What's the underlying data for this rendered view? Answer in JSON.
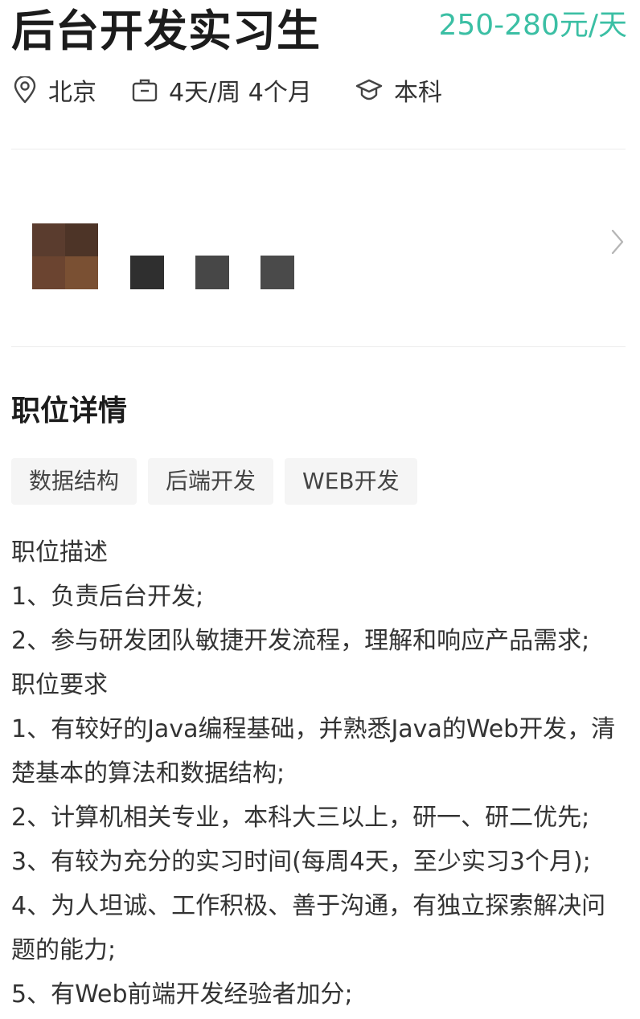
{
  "header": {
    "title": "后台开发实习生",
    "salary": "250-280元/天"
  },
  "meta": {
    "location": "北京",
    "schedule": "4天/周 4个月",
    "education": "本科",
    "icons": [
      "location-pin-icon",
      "briefcase-icon",
      "graduation-cap-icon"
    ]
  },
  "details": {
    "section_title": "职位详情",
    "tags": [
      "数据结构",
      "后端开发",
      "WEB开发"
    ],
    "lines": [
      "职位描述",
      "1、负责后台开发;",
      "2、参与研发团队敏捷开发流程，理解和响应产品需求;",
      "职位要求",
      "1、有较好的Java编程基础，并熟悉Java的Web开发，清",
      "楚基本的算法和数据结构;",
      "2、计算机相关专业，本科大三以上，研一、研二优先;",
      "3、有较为充分的实习时间(每周4天，至少实习3个月);",
      "4、为人坦诚、工作积极、善于沟通，有独立探索解决问",
      "题的能力;",
      "5、有Web前端开发经验者加分;"
    ]
  },
  "colors": {
    "salary": "#3bbfa4",
    "title": "#1c1c1c",
    "tag_background": "#f5f5f5"
  }
}
